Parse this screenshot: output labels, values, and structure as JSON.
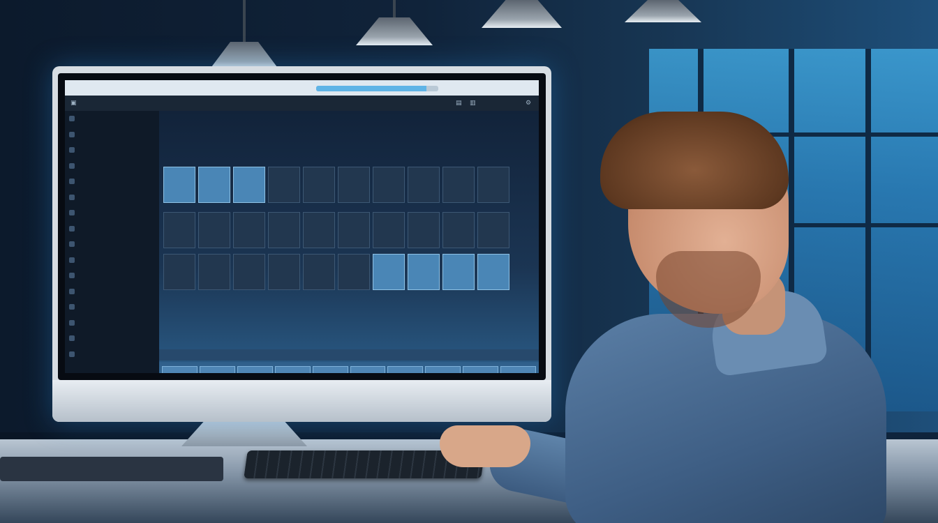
{
  "scene": {
    "description_colors": {
      "glow": "#3fa3da",
      "shirt": "#5b7fa6",
      "hair": "#5d3820"
    }
  },
  "screen_ui": {
    "title_left": "",
    "title_center": "",
    "progress": 0.9,
    "toolbar_icons": [
      "window-icon",
      "file-icon",
      "folder-icon",
      "settings-icon"
    ],
    "sidebar": {
      "items": [
        {
          "label": "",
          "icon": "sidebar-item-icon"
        },
        {
          "label": "",
          "icon": "sidebar-item-icon"
        },
        {
          "label": "",
          "icon": "sidebar-item-icon"
        },
        {
          "label": "",
          "icon": "sidebar-item-icon"
        },
        {
          "label": "",
          "icon": "sidebar-item-icon"
        },
        {
          "label": "",
          "icon": "sidebar-item-icon"
        },
        {
          "label": "",
          "icon": "sidebar-item-icon"
        },
        {
          "label": "",
          "icon": "sidebar-item-icon"
        },
        {
          "label": "",
          "icon": "sidebar-item-icon"
        },
        {
          "label": "",
          "icon": "sidebar-item-icon"
        },
        {
          "label": "",
          "icon": "sidebar-item-icon"
        },
        {
          "label": "",
          "icon": "sidebar-item-icon"
        },
        {
          "label": "",
          "icon": "sidebar-item-icon"
        },
        {
          "label": "",
          "icon": "sidebar-item-icon"
        },
        {
          "label": "",
          "icon": "sidebar-item-icon"
        },
        {
          "label": "",
          "icon": "sidebar-item-icon"
        }
      ]
    },
    "tiles_row1": [
      "",
      "",
      "",
      "",
      "",
      "",
      "",
      "",
      "",
      ""
    ],
    "tiles_row2": [
      "",
      "",
      "",
      "",
      "",
      "",
      "",
      "",
      "",
      ""
    ],
    "tiles_row3": [
      "",
      "",
      "",
      "",
      "",
      "",
      "",
      "",
      "",
      ""
    ],
    "strip_cells": 10
  }
}
